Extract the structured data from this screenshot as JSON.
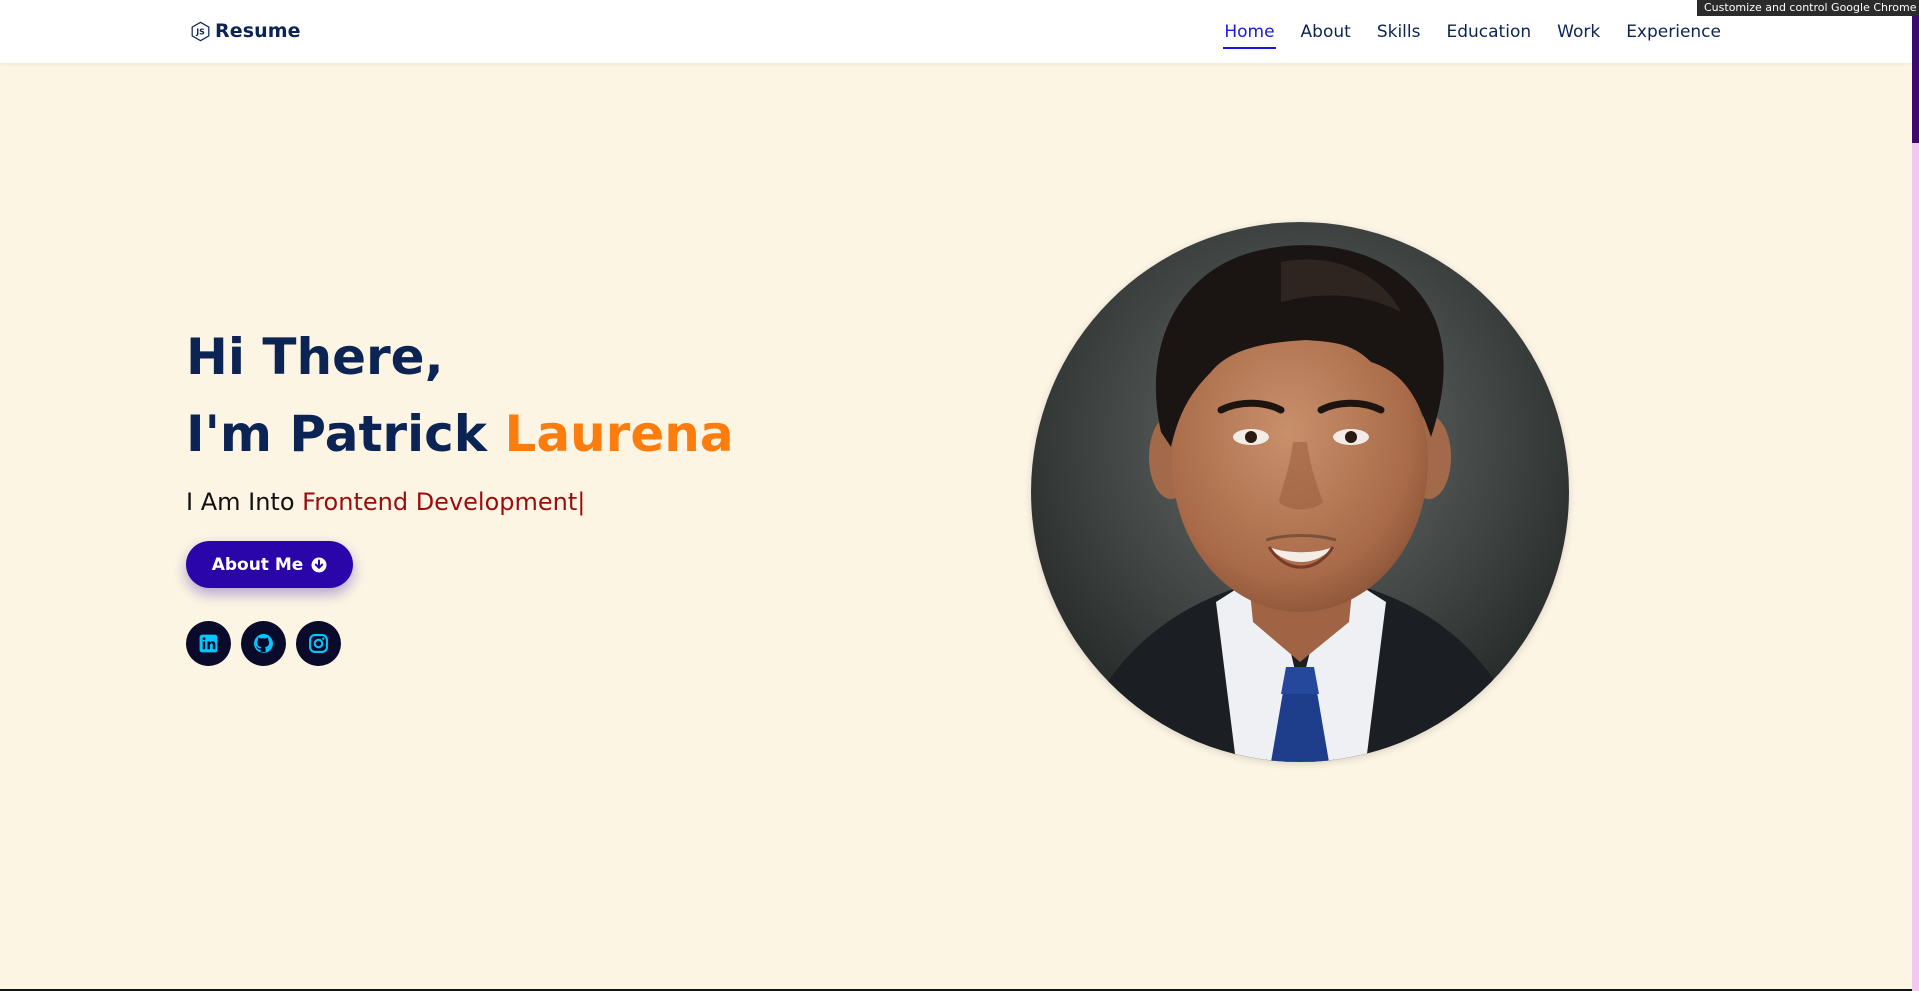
{
  "header": {
    "logo_text": "Resume",
    "nav": [
      {
        "label": "Home",
        "active": true
      },
      {
        "label": "About",
        "active": false
      },
      {
        "label": "Skills",
        "active": false
      },
      {
        "label": "Education",
        "active": false
      },
      {
        "label": "Work",
        "active": false
      },
      {
        "label": "Experience",
        "active": false
      }
    ]
  },
  "browser": {
    "tooltip": "Customize and control Google Chrome"
  },
  "hero": {
    "greeting": "Hi There,",
    "name_prefix": "I'm Patrick",
    "name_accent": "Laurena",
    "into_prefix": "I Am Into",
    "typed_text": "Frontend Development",
    "caret": "|",
    "button_label": "About Me",
    "button_icon": "arrow-circle-down-icon",
    "socials": [
      {
        "icon": "linkedin-icon"
      },
      {
        "icon": "github-icon"
      },
      {
        "icon": "instagram-icon"
      }
    ],
    "portrait": "profile-photo"
  },
  "colors": {
    "background": "#fdf5e4",
    "navy": "#0b2454",
    "accent_orange": "#fc7d0d",
    "accent_red": "#9b0c0c",
    "button": "#2a06aa",
    "nav_active": "#1a1ad8",
    "social_icon": "#00c8ff"
  }
}
